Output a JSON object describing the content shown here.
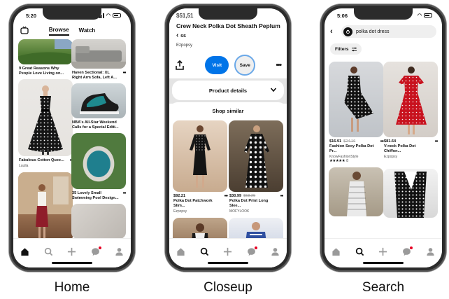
{
  "phones": {
    "home": {
      "label": "Home",
      "time": "5:20",
      "tabs": [
        "Browse",
        "Watch"
      ],
      "pins": {
        "p1": "9 Great Reasons Why People Love Living on...",
        "p2": "Fabulous Cotton Quee...",
        "p2_sub": "Luulla",
        "p3": "Haven Sectional: XL Right Arm Sofa, Left A...",
        "p4": "NBA's All-Star Weekend Calls for a Special Editi...",
        "p5": "35 Lovely Small Swimming Pool Design..."
      }
    },
    "closeup": {
      "label": "Closeup",
      "price_ghost": "$51,51",
      "title": "Crew Neck Polka Dot Sheath Peplum",
      "title_overflow": "ss",
      "brand": "Ezpopsy",
      "visit": "Visit",
      "save": "Save",
      "product_details": "Product details",
      "shop_similar": "Shop similar",
      "items": [
        {
          "price": "$92.21",
          "old": "",
          "name": "Polka Dot Patchwork Slim...",
          "store": "Ezpopsy"
        },
        {
          "price": "$30.99",
          "old": "$58.25",
          "name": "Polka Dot Print Long Slee...",
          "store": "MOFYLOOK"
        }
      ]
    },
    "search": {
      "label": "Search",
      "time": "5:06",
      "query": "polka dot dress",
      "filters": "Filters",
      "items": [
        {
          "price": "$16.91",
          "old": "$24.16",
          "name": "Fashion Sexy Polka Dot Pr...",
          "store": "KnowFashionStyle",
          "rating_count": "8"
        },
        {
          "price": "$81.64",
          "old": "",
          "name": "V-neck Polka Dot Chiffon...",
          "store": "Ezpopsy",
          "rating_count": ""
        }
      ]
    }
  },
  "colors": {
    "pinterest_red": "#e60023",
    "visit_blue": "#0074e8",
    "save_ring": "#6aa8e8"
  },
  "icons": [
    "home-icon",
    "search-icon",
    "plus-icon",
    "messages-icon",
    "profile-icon",
    "tv-icon",
    "share-icon",
    "chevron-down-icon",
    "back-arrow-icon",
    "filters-icon"
  ]
}
